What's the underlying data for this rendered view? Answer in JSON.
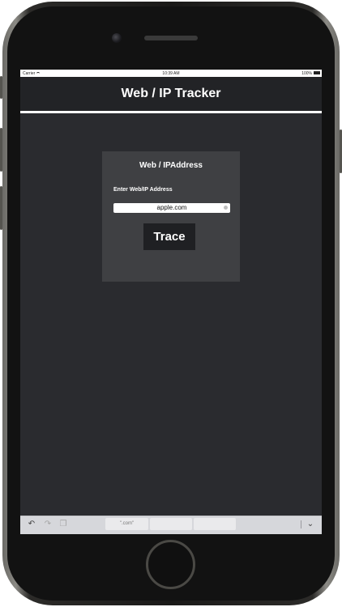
{
  "status_bar": {
    "carrier": "Carrier",
    "time": "10:39 AM",
    "battery": "100%"
  },
  "nav": {
    "title": "Web / IP Tracker"
  },
  "card": {
    "title": "Web / IPAddress",
    "field_label": "Enter Web/IP Address",
    "address_value": "apple.com",
    "trace_label": "Trace"
  },
  "keyboard_bar": {
    "suggestion_1": "\".com\"",
    "suggestion_2": "",
    "suggestion_3": ""
  },
  "icons": {
    "wifi": "wifi-icon",
    "battery": "battery-icon",
    "clear": "clear-icon",
    "undo": "undo-icon",
    "redo": "redo-icon",
    "paste": "paste-icon",
    "dismiss": "chevron-down-icon"
  },
  "colors": {
    "screen_background": "#2a2b2f",
    "nav_background": "#222326",
    "card_background": "#3f4043",
    "button_background": "#1f2023",
    "text": "#ffffff"
  }
}
